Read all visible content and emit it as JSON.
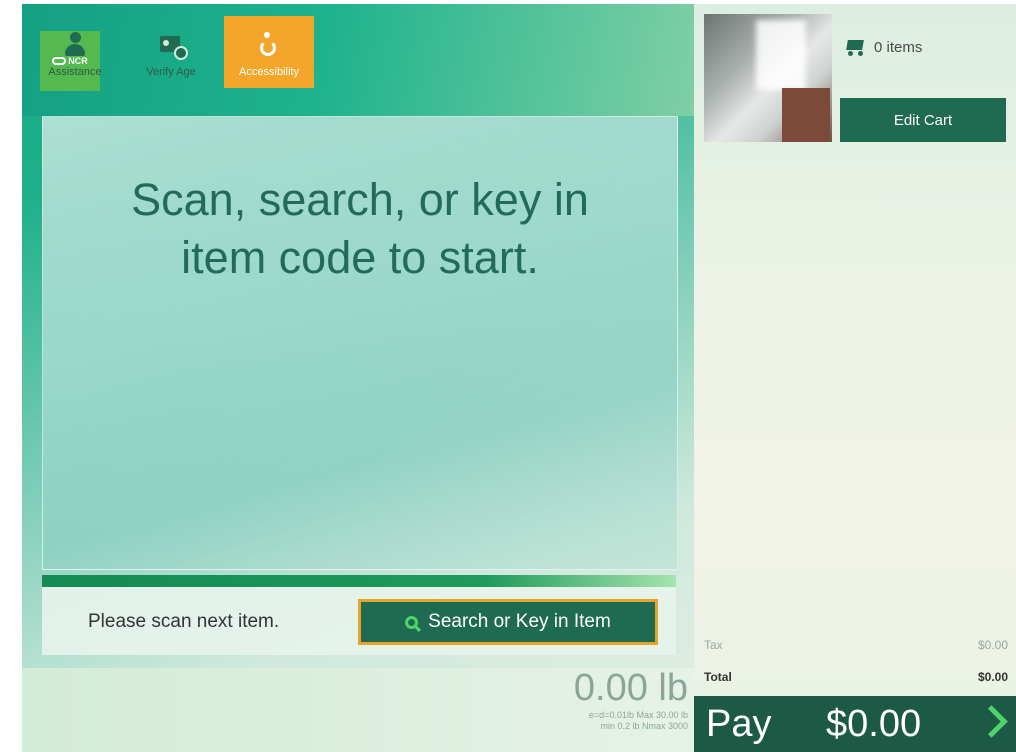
{
  "brand": {
    "logo_text": "NCR"
  },
  "main": {
    "headline_line1": "Scan, search, or key in",
    "headline_line2": "item code to start."
  },
  "status": {
    "message": "Please scan next item.",
    "search_button_label": "Search or Key in Item"
  },
  "tools": [
    {
      "label": "Assistance",
      "icon": "person-icon"
    },
    {
      "label": "Verify Age",
      "icon": "id-card-icon"
    },
    {
      "label": "Accessibility",
      "icon": "wheelchair-icon",
      "active": true
    }
  ],
  "scale": {
    "weight": "0.00 lb",
    "meta_line1": "e=d=0.01lb Max 30.00 lb",
    "meta_line2": "min 0.2 lb Nmax 3000"
  },
  "cart": {
    "item_count": "0 items",
    "edit_button_label": "Edit Cart",
    "tax_label": "Tax",
    "tax_value": "$0.00",
    "total_label": "Total",
    "total_value": "$0.00"
  },
  "pay": {
    "label": "Pay",
    "amount": "$0.00"
  },
  "colors": {
    "accent_green": "#1f6a50",
    "highlight_orange": "#f3a62a",
    "pay_bar": "#1d5a45"
  }
}
